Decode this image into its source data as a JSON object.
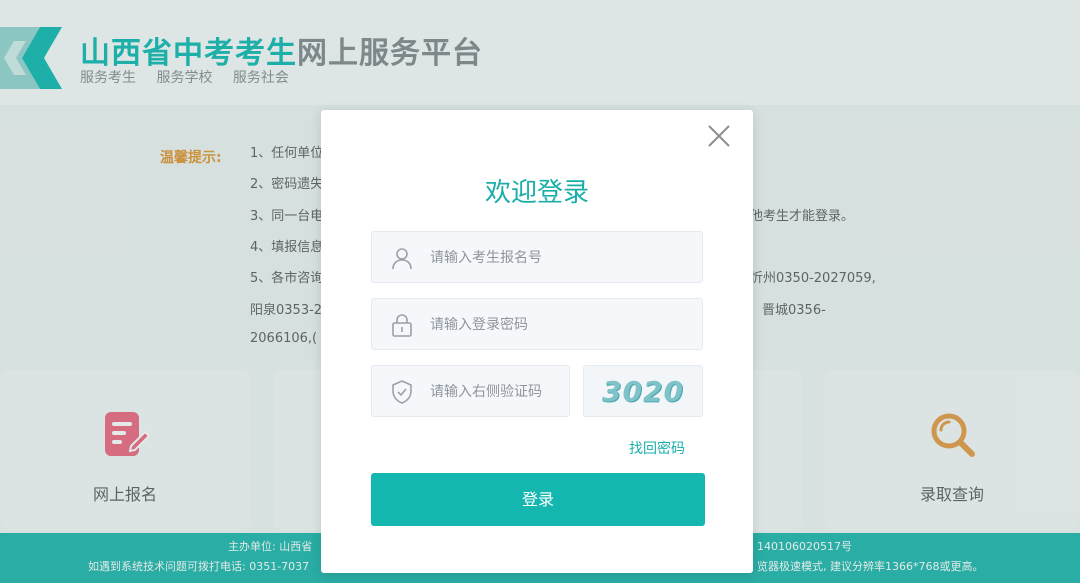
{
  "header": {
    "title_highlight": "山西省中考考生",
    "title_rest": "网上服务平台",
    "slogans": [
      "服务考生",
      "服务学校",
      "服务社会"
    ]
  },
  "tips": {
    "label": "温馨提示:",
    "lines": [
      "1、任何单位",
      "2、密码遗失",
      "3、同一台电",
      "他考生才能登录。",
      "4、填报信息",
      "5、各市咨询",
      "忻州0350-2027059,",
      "阳泉0353-2",
      "晋城0356-",
      "2066106,("
    ]
  },
  "cards": {
    "signup": "网上报名",
    "admission": "录取查询"
  },
  "footer": {
    "line1_left": "主办单位: 山西省",
    "line1_right": "140106020517号",
    "line2_left": "如遇到系统技术问题可拨打电话: 0351-7037",
    "line2_right": "览器极速模式, 建议分辨率1366*768或更高。"
  },
  "modal": {
    "title": "欢迎登录",
    "username_placeholder": "请输入考生报名号",
    "password_placeholder": "请输入登录密码",
    "captcha_placeholder": "请输入右侧验证码",
    "captcha_text": "3020",
    "forgot_label": "找回密码",
    "login_label": "登录"
  },
  "colors": {
    "brand": "#1dbcb6",
    "accent_button": "#14b7b0",
    "tips_label": "#e49b3c",
    "footer": "#2ab9b0"
  },
  "icons": {
    "logo": "k-chevron-logo",
    "signup": "edit-note-icon",
    "admission": "search-icon",
    "close": "close-icon",
    "user": "user-icon",
    "lock": "lock-icon",
    "shield": "shield-check-icon"
  }
}
